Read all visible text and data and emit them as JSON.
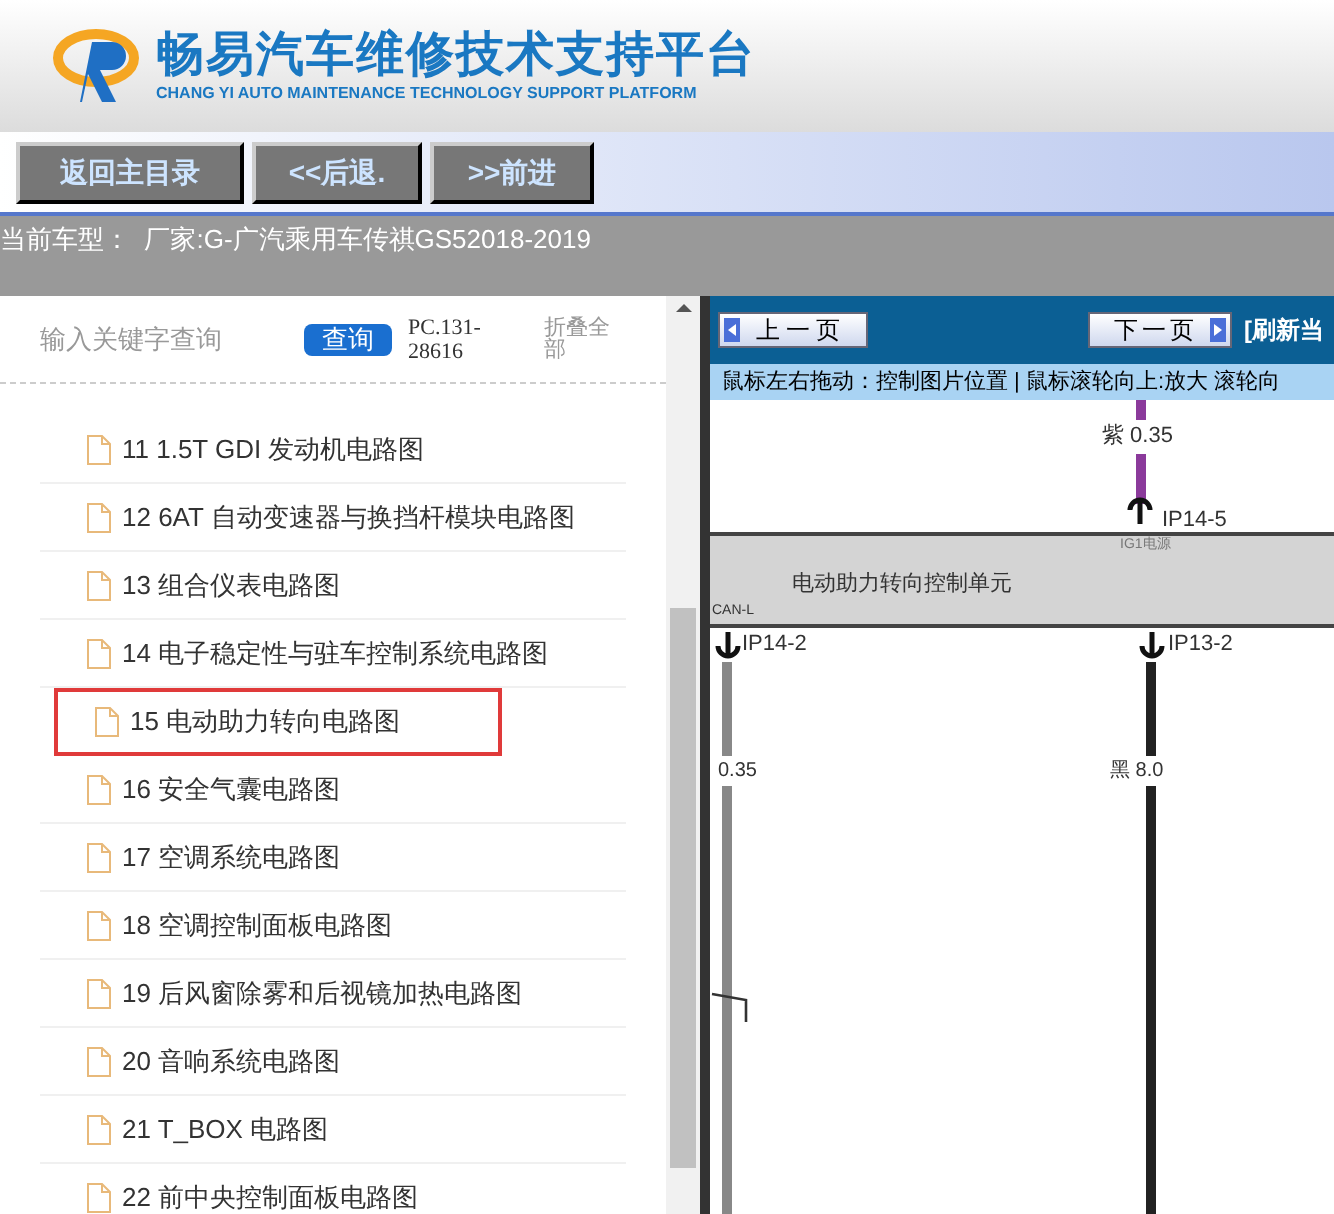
{
  "header": {
    "title": "畅易汽车维修技术支持平台",
    "subtitle": "CHANG YI AUTO MAINTENANCE TECHNOLOGY SUPPORT PLATFORM"
  },
  "toolbar": {
    "buttons": [
      "返回主目录",
      "<<后退.",
      ">>前进"
    ]
  },
  "vehicle": {
    "text": "当前车型：  厂家:G-广汽乘用车传祺GS52018-2019"
  },
  "sidebar": {
    "search": {
      "placeholder": "输入关键字查询",
      "button": "查询"
    },
    "code": "PC.131-28616",
    "collapse": "折叠全部",
    "items": [
      {
        "label": "11 1.5T GDI 发动机电路图",
        "selected": false
      },
      {
        "label": "12 6AT 自动变速器与换挡杆模块电路图",
        "selected": false
      },
      {
        "label": "13 组合仪表电路图",
        "selected": false
      },
      {
        "label": "14 电子稳定性与驻车控制系统电路图",
        "selected": false
      },
      {
        "label": "15 电动助力转向电路图",
        "selected": true
      },
      {
        "label": "16 安全气囊电路图",
        "selected": false
      },
      {
        "label": "17 空调系统电路图",
        "selected": false
      },
      {
        "label": "18 空调控制面板电路图",
        "selected": false
      },
      {
        "label": "19 后风窗除雾和后视镜加热电路图",
        "selected": false
      },
      {
        "label": "20 音响系统电路图",
        "selected": false
      },
      {
        "label": "21 T_BOX 电路图",
        "selected": false
      },
      {
        "label": "22 前中央控制面板电路图",
        "selected": false
      }
    ]
  },
  "viewer": {
    "prev": "上一页",
    "next": "下一页",
    "refresh": "[刷新当",
    "hint": "鼠标左右拖动：控制图片位置 | 鼠标滚轮向上:放大  滚轮向",
    "diagram": {
      "wire_top_label": "紫 0.35",
      "pin_top": "IP14-5",
      "power_label": "IG1电源",
      "unit": "电动助力转向控制单元",
      "can_label": "CAN-L",
      "pin_left": "IP14-2",
      "pin_right": "IP13-2",
      "wire_left_label": "0.35",
      "wire_right_label": "黑 8.0"
    }
  }
}
